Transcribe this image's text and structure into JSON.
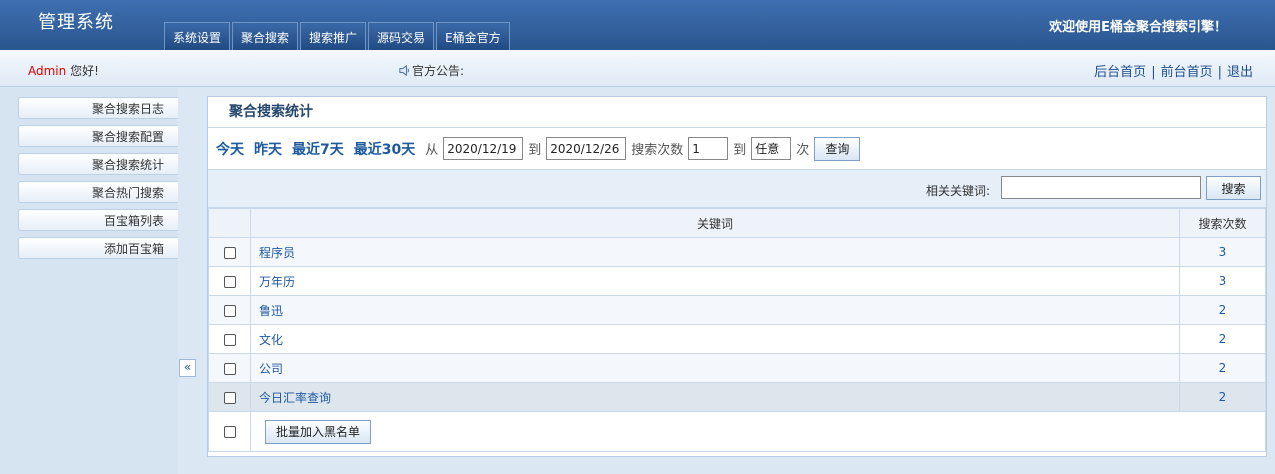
{
  "header": {
    "logo": "管理系统",
    "tabs": [
      {
        "label": "系统设置"
      },
      {
        "label": "聚合搜索"
      },
      {
        "label": "搜索推广"
      },
      {
        "label": "源码交易"
      },
      {
        "label": "E桶金官方"
      }
    ],
    "welcome": "欢迎使用E桶金聚合搜索引擎！"
  },
  "subbar": {
    "user": "Admin",
    "greeting": "您好!",
    "notice_label": "官方公告:",
    "links": [
      {
        "label": "后台首页"
      },
      {
        "label": "前台首页"
      },
      {
        "label": "退出"
      }
    ]
  },
  "sidebar": {
    "items": [
      {
        "label": "聚合搜索日志"
      },
      {
        "label": "聚合搜索配置"
      },
      {
        "label": "聚合搜索统计"
      },
      {
        "label": "聚合热门搜索"
      },
      {
        "label": "百宝箱列表"
      },
      {
        "label": "添加百宝箱"
      }
    ],
    "collapse": "«"
  },
  "panel": {
    "title": "聚合搜索统计",
    "quick": [
      {
        "label": "今天"
      },
      {
        "label": "昨天"
      },
      {
        "label": "最近7天"
      },
      {
        "label": "最近30天"
      }
    ],
    "from_label": "从",
    "date_from": "2020/12/19",
    "to_label": "到",
    "date_to": "2020/12/26",
    "count_label": "搜索次数",
    "count_min": "1",
    "to_label2": "到",
    "count_max": "任意",
    "times_label": "次",
    "query_button": "查询",
    "keyword_label": "相关关键词:",
    "keyword_value": "",
    "search_button": "搜索",
    "table": {
      "headers": {
        "keyword": "关键词",
        "count": "搜索次数"
      },
      "rows": [
        {
          "keyword": "程序员",
          "count": "3"
        },
        {
          "keyword": "万年历",
          "count": "3"
        },
        {
          "keyword": "鲁迅",
          "count": "2"
        },
        {
          "keyword": "文化",
          "count": "2"
        },
        {
          "keyword": "公司",
          "count": "2"
        },
        {
          "keyword": "今日汇率查询",
          "count": "2"
        }
      ]
    },
    "blacklist_button": "批量加入黑名单"
  }
}
